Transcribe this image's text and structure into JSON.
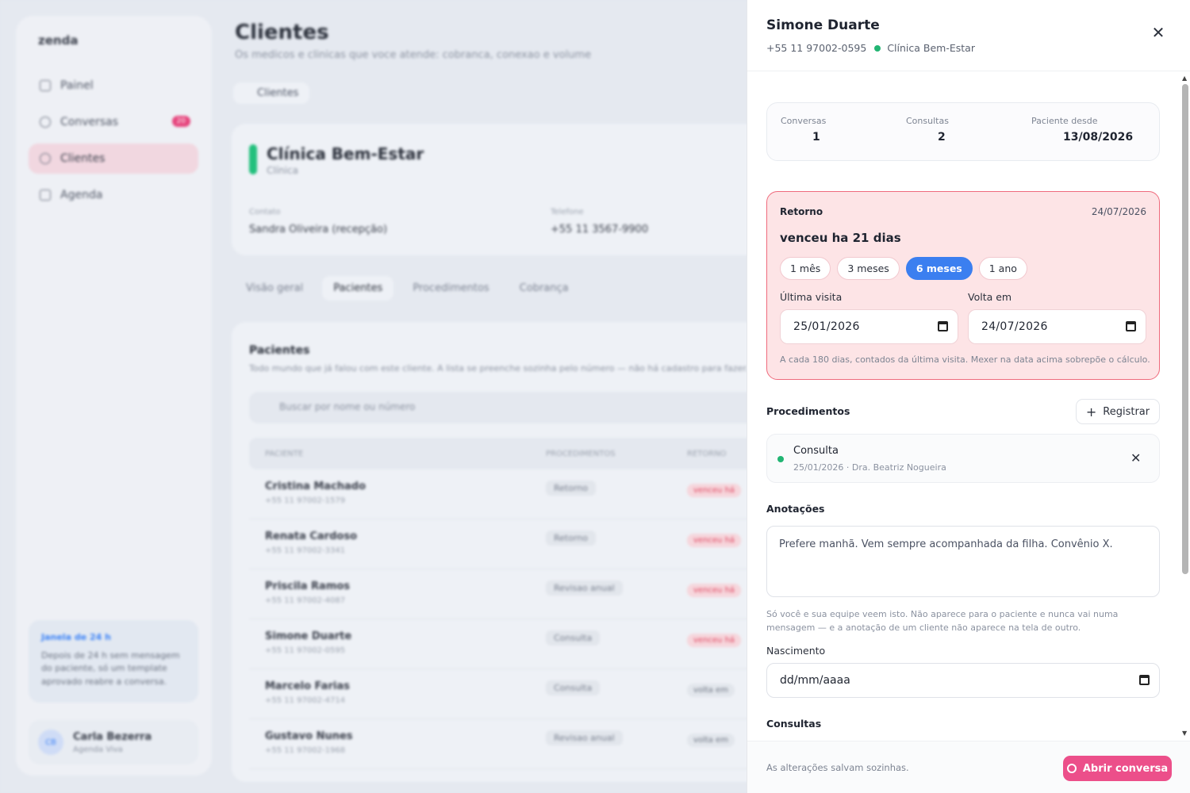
{
  "background": {
    "brand": "zenda",
    "nav": [
      {
        "label": "Painel"
      },
      {
        "label": "Conversas",
        "badge": "20"
      },
      {
        "label": "Clientes"
      },
      {
        "label": "Agenda"
      }
    ],
    "side_card": {
      "title": "Janela de 24 h",
      "text": "Depois de 24 h sem mensagem do paciente, só um template aprovado reabre a conversa."
    },
    "user": {
      "initials": "CB",
      "name": "Carla Bezerra",
      "role": "Agenda Viva"
    },
    "page_title": "Clientes",
    "page_subtitle": "Os medicos e clinicas que voce atende: cobranca, conexao e volume",
    "breadcrumb": "Clientes",
    "client": {
      "name": "Clínica Bem-Estar",
      "type": "Clínica",
      "contact_label": "Contato",
      "contact_value": "Sandra Oliveira (recepção)",
      "phone_label": "Telefone",
      "phone_value": "+55 11 3567-9900"
    },
    "tabs": [
      "Visão geral",
      "Pacientes",
      "Procedimentos",
      "Cobrança"
    ],
    "patients": {
      "title": "Pacientes",
      "subtitle": "Todo mundo que já falou com este cliente. A lista se preenche sozinha pelo número — não há cadastro para fazer.",
      "search_placeholder": "Buscar por nome ou número",
      "columns": [
        "PACIENTE",
        "PROCEDIMENTOS",
        "RETORNO"
      ],
      "rows": [
        {
          "name": "Cristina Machado",
          "phone": "+55 11 97002-1579",
          "proc": "Retorno",
          "ret": "venceu há",
          "ok": false
        },
        {
          "name": "Renata Cardoso",
          "phone": "+55 11 97002-3341",
          "proc": "Retorno",
          "ret": "venceu há",
          "ok": false
        },
        {
          "name": "Priscila Ramos",
          "phone": "+55 11 97002-4087",
          "proc": "Revisao anual",
          "ret": "venceu há",
          "ok": false
        },
        {
          "name": "Simone Duarte",
          "phone": "+55 11 97002-0595",
          "proc": "Consulta",
          "ret": "venceu há",
          "ok": false
        },
        {
          "name": "Marcelo Farias",
          "phone": "+55 11 97002-4714",
          "proc": "Consulta",
          "ret": "volta em",
          "ok": true
        },
        {
          "name": "Gustavo Nunes",
          "phone": "+55 11 97002-1968",
          "proc": "Revisao anual",
          "ret": "volta em",
          "ok": true
        }
      ]
    }
  },
  "drawer": {
    "name": "Simone Duarte",
    "phone": "+55 11 97002-0595",
    "clinic": "Clínica Bem-Estar",
    "stats": [
      {
        "label": "Conversas",
        "value": "1"
      },
      {
        "label": "Consultas",
        "value": "2"
      },
      {
        "label": "Paciente desde",
        "value": "13/08/2026"
      }
    ],
    "retorno": {
      "label": "Retorno",
      "date": "24/07/2026",
      "status": "venceu ha 21 dias",
      "chips": [
        "1 mês",
        "3 meses",
        "6 meses",
        "1 ano"
      ],
      "active_chip": "6 meses",
      "last_visit_label": "Última visita",
      "last_visit_value": "25/01/2026",
      "return_label": "Volta em",
      "return_value": "24/07/2026",
      "note": "A cada 180 dias, contados da última visita. Mexer na data acima sobrepõe o cálculo."
    },
    "procedimentos": {
      "title": "Procedimentos",
      "register_label": "Registrar",
      "items": [
        {
          "name": "Consulta",
          "detail": "25/01/2026 · Dra. Beatriz Nogueira"
        }
      ]
    },
    "anotacoes": {
      "title": "Anotações",
      "value": "Prefere manhã. Vem sempre acompanhada da filha. Convênio X.",
      "help": "Só você e sua equipe veem isto. Não aparece para o paciente e nunca vai numa mensagem — e a anotação de um cliente não aparece na tela de outro."
    },
    "nascimento": {
      "label": "Nascimento",
      "placeholder": "dd/mm/aaaa"
    },
    "consultas_title": "Consultas",
    "footer": {
      "autosave": "As alterações salvam sozinhas.",
      "open_label": "Abrir conversa"
    },
    "colors": {
      "accent_pink": "#ec4f8a",
      "accent_blue": "#3b7ff0",
      "danger": "#ef6b7d",
      "success": "#22b573"
    }
  }
}
